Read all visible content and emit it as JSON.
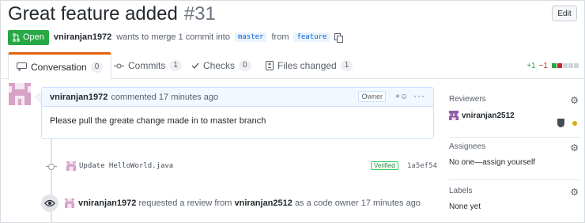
{
  "header": {
    "title": "Great feature added",
    "number": "#31",
    "edit_label": "Edit"
  },
  "meta": {
    "state": "Open",
    "author": "vniranjan1972",
    "text_mid": "wants to merge 1 commit into",
    "base_branch": "master",
    "from_text": "from",
    "head_branch": "feature"
  },
  "tabs": [
    {
      "label": "Conversation",
      "count": "0",
      "icon": "comment-icon"
    },
    {
      "label": "Commits",
      "count": "1",
      "icon": "commit-icon"
    },
    {
      "label": "Checks",
      "count": "0",
      "icon": "checks-icon"
    },
    {
      "label": "Files changed",
      "count": "1",
      "icon": "file-diff-icon"
    }
  ],
  "diffstat": {
    "additions": "+1",
    "deletions": "−1"
  },
  "comment": {
    "author": "vniranjan1972",
    "time": "commented 17 minutes ago",
    "role": "Owner",
    "reaction_label": "+☺",
    "more_label": "···",
    "body": "Please pull the greate change made in to master branch"
  },
  "commit": {
    "message": "Update HelloWorld.java",
    "verified": "Verified",
    "sha": "1a5ef54"
  },
  "review_event": {
    "actor": "vniranjan1972",
    "text1": "requested a review from",
    "reviewer": "vniranjan2512",
    "text2": "as a code owner 17 minutes ago"
  },
  "sidebar": {
    "reviewers_title": "Reviewers",
    "reviewer_name": "vniranjan2512",
    "assignees_title": "Assignees",
    "assignees_value": "No one—assign yourself",
    "labels_title": "Labels",
    "labels_value": "None yet"
  },
  "colors": {
    "open_green": "#28a745",
    "tab_accent": "#e36209",
    "avatar_pink": "#d6a2c6",
    "avatar_purple": "#8f5aa8"
  }
}
